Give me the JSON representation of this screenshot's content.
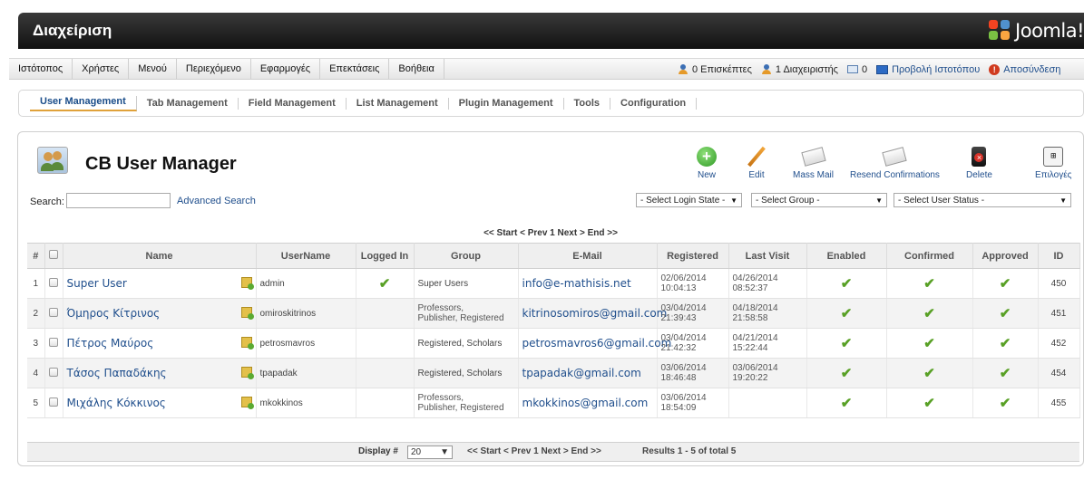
{
  "header": {
    "title": "Διαχείριση",
    "logo_text": "Joomla!"
  },
  "menu": {
    "items": [
      "Ιστότοπος",
      "Χρήστες",
      "Μενού",
      "Περιεχόμενο",
      "Εφαρμογές",
      "Επεκτάσεις",
      "Βοήθεια"
    ],
    "status": {
      "visitors": "0 Επισκέπτες",
      "admins": "1 Διαχειριστής",
      "messages": "0",
      "view_site": "Προβολή Ιστοτόπου",
      "logout": "Αποσύνδεση"
    }
  },
  "tabs": [
    "User Management",
    "Tab Management",
    "Field Management",
    "List Management",
    "Plugin Management",
    "Tools",
    "Configuration"
  ],
  "panel": {
    "title": "CB User Manager",
    "toolbar": {
      "new": "New",
      "edit": "Edit",
      "mass_mail": "Mass Mail",
      "resend": "Resend Confirmations",
      "delete": "Delete",
      "options": "Επιλογές"
    },
    "search_label": "Search:",
    "advanced_search": "Advanced Search",
    "filters": {
      "login_state": "- Select Login State -",
      "group": "- Select Group -",
      "user_status": "- Select User Status -"
    },
    "pager_top": "<< Start < Prev 1 Next > End >>"
  },
  "table": {
    "headers": {
      "num": "#",
      "name": "Name",
      "username": "UserName",
      "logged_in": "Logged In",
      "group": "Group",
      "email": "E-Mail",
      "registered": "Registered",
      "last_visit": "Last Visit",
      "enabled": "Enabled",
      "confirmed": "Confirmed",
      "approved": "Approved",
      "id": "ID"
    },
    "rows": [
      {
        "n": "1",
        "name": "Super User",
        "username": "admin",
        "logged_in": "✔",
        "group": "Super Users",
        "email": "info@e-mathisis.net",
        "reg_date": "02/06/2014",
        "reg_time": "10:04:13",
        "lv_date": "04/26/2014",
        "lv_time": "08:52:37",
        "id": "450"
      },
      {
        "n": "2",
        "name": "Όμηρος Κίτρινος",
        "username": "omiroskitrinos",
        "logged_in": "",
        "group_l1": "Professors,",
        "group_l2": "Publisher, Registered",
        "email": "kitrinosomiros@gmail.com",
        "reg_date": "03/04/2014",
        "reg_time": "21:39:43",
        "lv_date": "04/18/2014",
        "lv_time": "21:58:58",
        "id": "451"
      },
      {
        "n": "3",
        "name": "Πέτρος Μαύρος",
        "username": "petrosmavros",
        "logged_in": "",
        "group": "Registered, Scholars",
        "email": "petrosmavros6@gmail.com",
        "reg_date": "03/04/2014",
        "reg_time": "21:42:32",
        "lv_date": "04/21/2014",
        "lv_time": "15:22:44",
        "id": "452"
      },
      {
        "n": "4",
        "name": "Τάσος Παπαδάκης",
        "username": "tpapadak",
        "logged_in": "",
        "group": "Registered, Scholars",
        "email": "tpapadak@gmail.com",
        "reg_date": "03/06/2014",
        "reg_time": "18:46:48",
        "lv_date": "03/06/2014",
        "lv_time": "19:20:22",
        "id": "454"
      },
      {
        "n": "5",
        "name": "Μιχάλης Κόκκινος",
        "username": "mkokkinos",
        "logged_in": "",
        "group_l1": "Professors,",
        "group_l2": "Publisher, Registered",
        "email": "mkokkinos@gmail.com",
        "reg_date": "03/06/2014",
        "reg_time": "18:54:09",
        "lv_date": "",
        "lv_time": "",
        "id": "455"
      }
    ],
    "check_glyph": "✔"
  },
  "footer": {
    "display_label": "Display #",
    "display_value": "20",
    "pager": "<< Start < Prev 1 Next > End >>",
    "results": "Results 1 - 5 of total 5"
  }
}
